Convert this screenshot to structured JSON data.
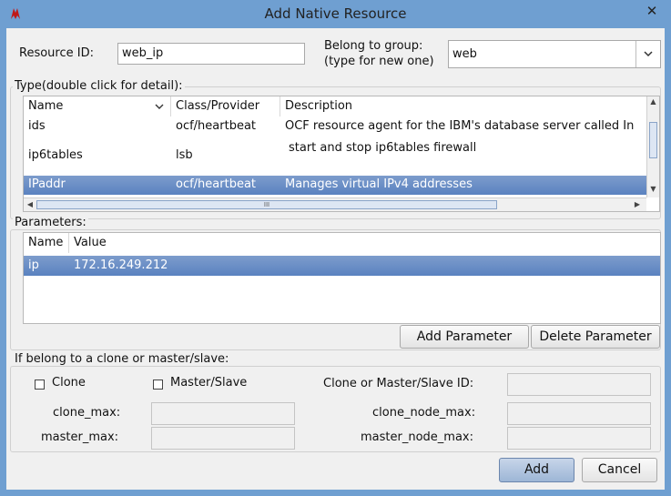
{
  "window": {
    "title": "Add Native Resource",
    "close_glyph": "✕"
  },
  "resource_id": {
    "label": "Resource ID:",
    "value": "web_ip"
  },
  "group_select": {
    "label_line1": "Belong to group:",
    "label_line2": "(type for new one)",
    "value": "web"
  },
  "type_section": {
    "title": "Type(double click for detail):",
    "headers": {
      "name": "Name",
      "class": "Class/Provider",
      "description": "Description"
    },
    "rows": [
      {
        "name": "ids",
        "class": "ocf/heartbeat",
        "description": "OCF resource agent for the IBM's database server called In"
      },
      {
        "name": "ip6tables",
        "class": "lsb",
        "description": "start and stop ip6tables firewall"
      },
      {
        "name": "IPaddr",
        "class": "ocf/heartbeat",
        "description": "Manages virtual IPv4 addresses"
      }
    ],
    "scroll_thumb_glyph": "III"
  },
  "parameters": {
    "title": "Parameters:",
    "headers": {
      "name": "Name",
      "value": "Value"
    },
    "rows": [
      {
        "name": "ip",
        "value": "172.16.249.212"
      }
    ],
    "add_button": "Add Parameter",
    "delete_button": "Delete Parameter"
  },
  "clone_section": {
    "title": "If belong to a clone or master/slave:",
    "clone_checkbox": "Clone",
    "master_slave_checkbox": "Master/Slave",
    "clone_id_label": "Clone or Master/Slave ID:",
    "clone_max_label": "clone_max:",
    "master_max_label": "master_max:",
    "clone_node_max_label": "clone_node_max:",
    "master_node_max_label": "master_node_max:"
  },
  "footer": {
    "add_button": "Add",
    "cancel_button": "Cancel"
  },
  "colors": {
    "selection": "#5a82c0",
    "window_frame": "#6f9fd1",
    "dialog_bg": "#f0f0f0"
  }
}
